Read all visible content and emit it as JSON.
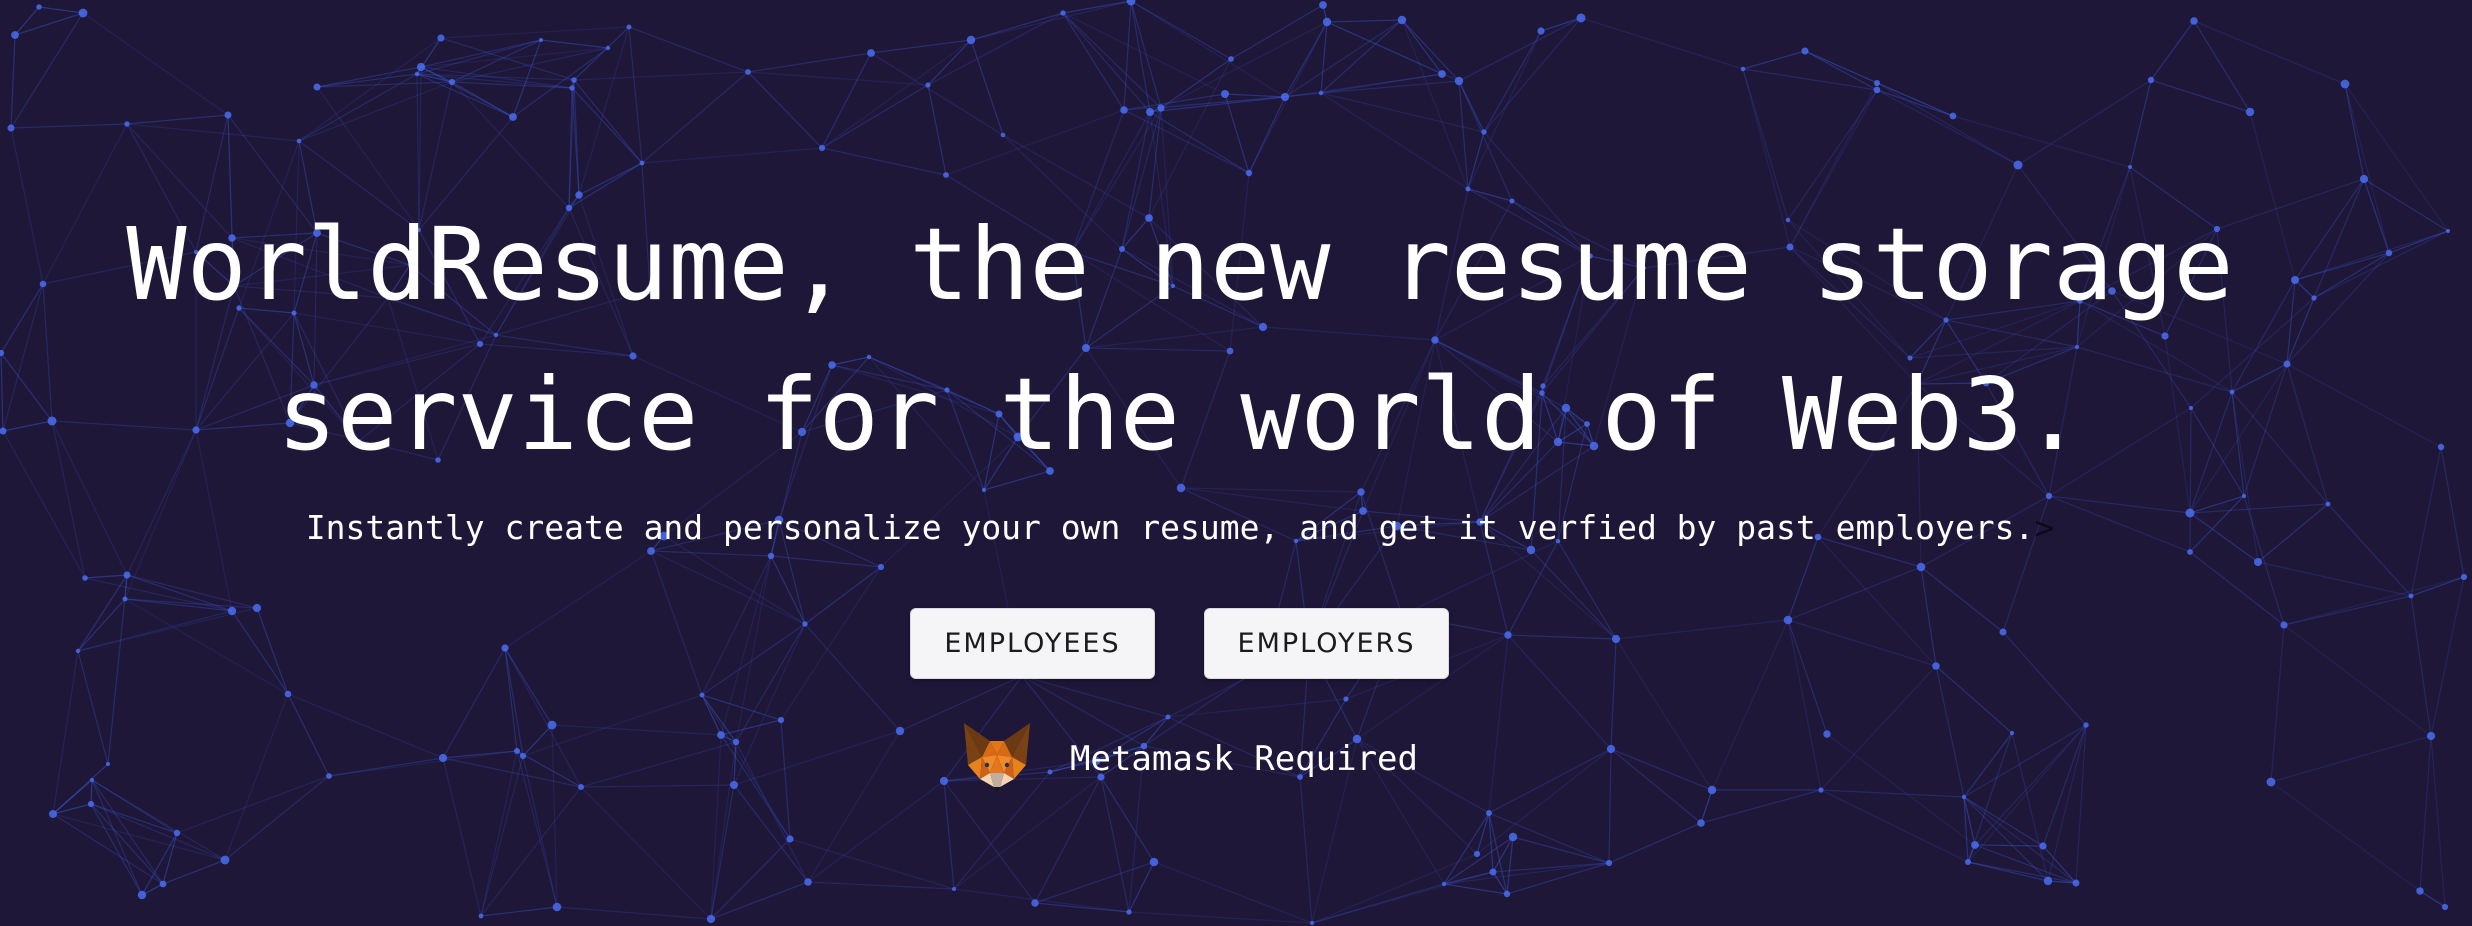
{
  "hero": {
    "headline_line1": "WorldResume, the new resume storage",
    "headline_line2": "service for the world of Web3.",
    "subtitle": "Instantly create and personalize your own resume, and get it verfied by past employers.",
    "caret": ">"
  },
  "actions": {
    "employees_label": "EMPLOYEES",
    "employers_label": "EMPLOYERS"
  },
  "metamask": {
    "icon": "metamask-fox-icon",
    "notice": "Metamask Required"
  },
  "colors": {
    "background": "#1f1738",
    "network_line": "#3b5bdb",
    "network_node": "#4a6cf0",
    "button_bg": "#f5f5f7",
    "text": "#ffffff"
  }
}
